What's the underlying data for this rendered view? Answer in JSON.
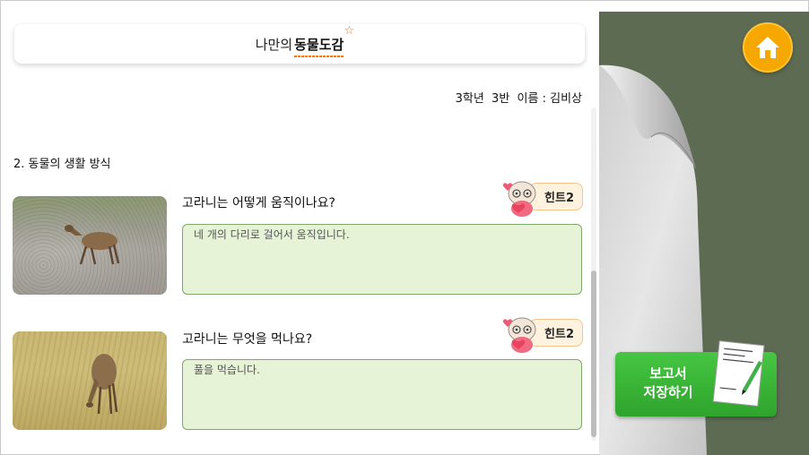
{
  "header": {
    "title_prefix": "나만의",
    "title_emphasis": "동물도감",
    "star_glyph": "☆"
  },
  "student": {
    "info": "3학년  3반  이름 : 김비상"
  },
  "section": {
    "title": "2. 동물의 생활 방식"
  },
  "cards": [
    {
      "question": "고라니는 어떻게 움직이나요?",
      "hint_label": "힌트2",
      "answer": "네 개의 다리로 걸어서 움직입니다."
    },
    {
      "question": "고라니는 무엇을 먹나요?",
      "hint_label": "힌트2",
      "answer": "풀을 먹습니다."
    }
  ],
  "save_button": {
    "line1": "보고서",
    "line2": "저장하기"
  },
  "colors": {
    "panel": "#5d6b53",
    "accent": "#f0781e",
    "home": "#f6a700",
    "save": "#3bb538",
    "answer_bg": "#e6f3d6"
  },
  "icons": {
    "home": "home-icon",
    "hint": "mascot-hint-icon",
    "document": "document-pen-icon"
  }
}
